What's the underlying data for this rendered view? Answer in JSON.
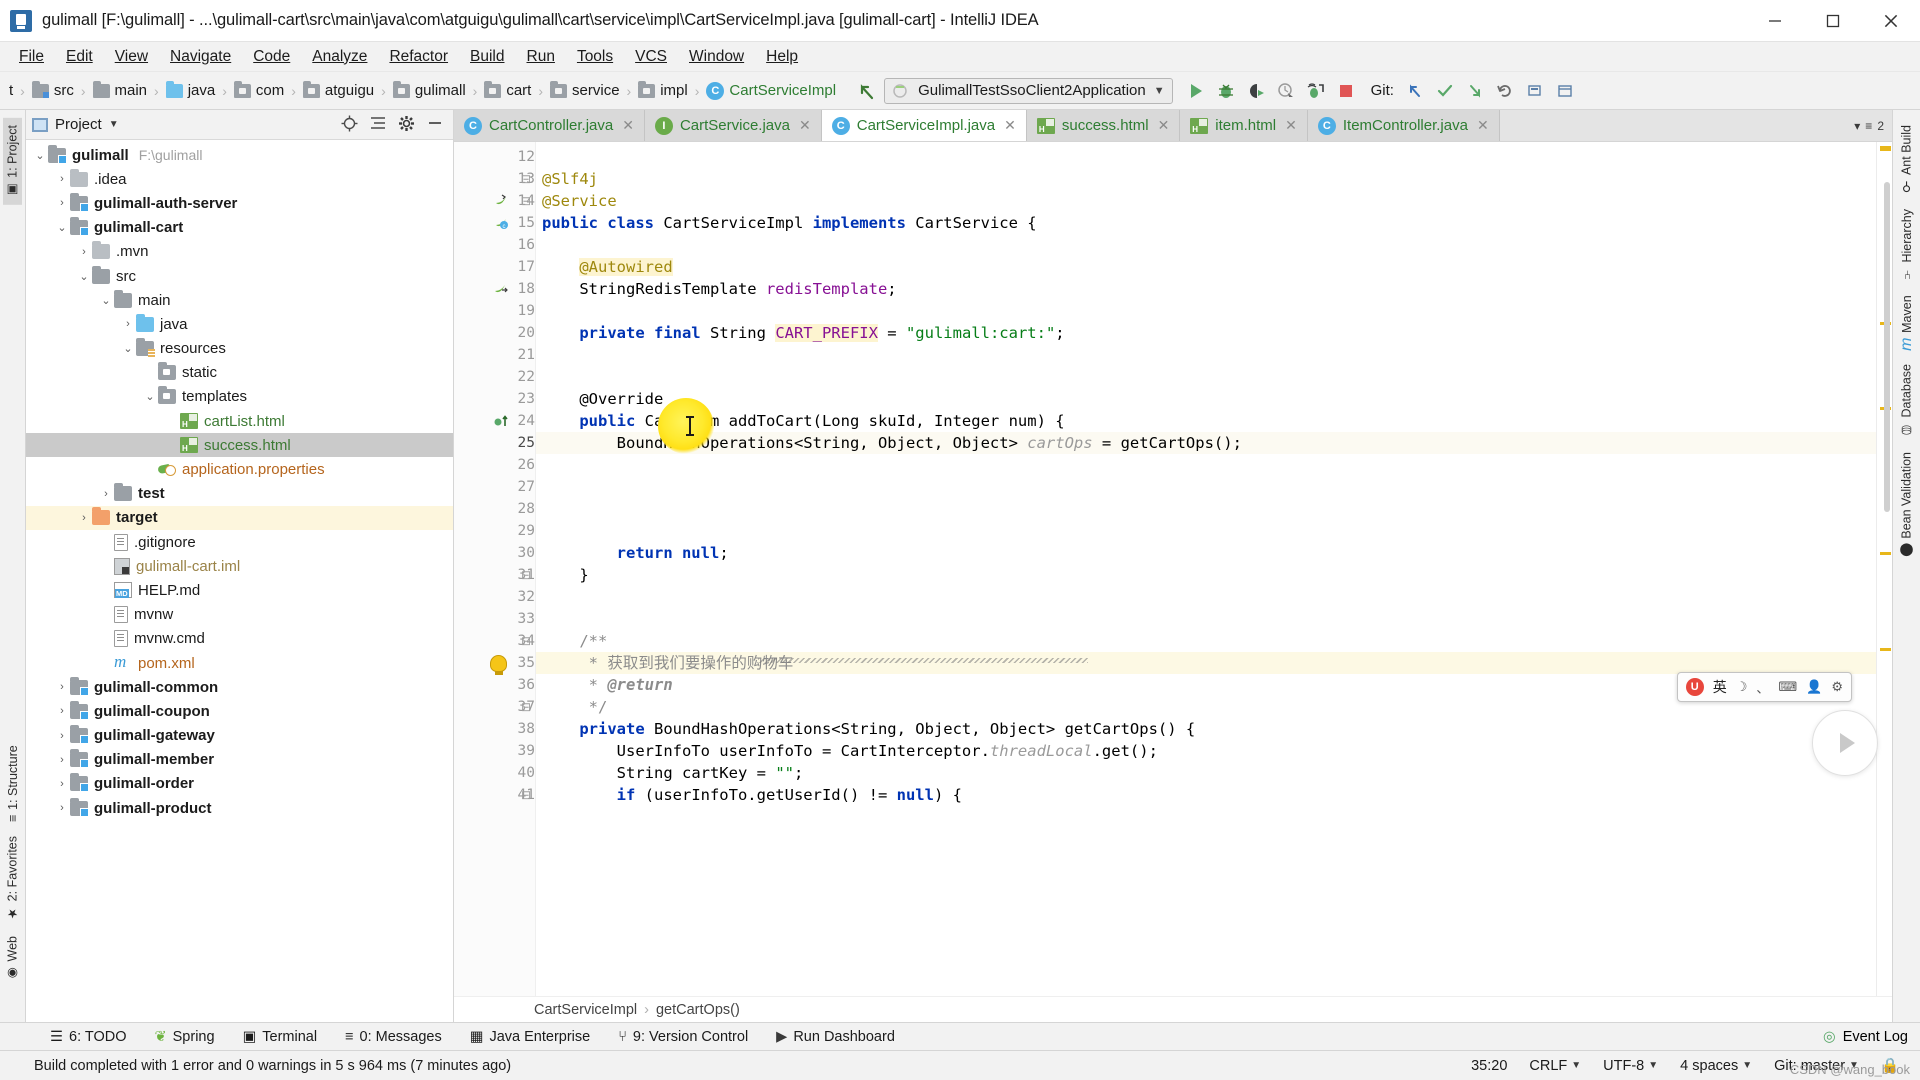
{
  "window": {
    "title": "gulimall [F:\\gulimall] - ...\\gulimall-cart\\src\\main\\java\\com\\atguigu\\gulimall\\cart\\service\\impl\\CartServiceImpl.java [gulimall-cart] - IntelliJ IDEA",
    "app_icon": "intellij-idea-icon",
    "minimize": "minimize-icon",
    "maximize": "maximize-icon",
    "close": "close-icon"
  },
  "menubar": [
    {
      "label": "File"
    },
    {
      "label": "Edit"
    },
    {
      "label": "View"
    },
    {
      "label": "Navigate"
    },
    {
      "label": "Code"
    },
    {
      "label": "Analyze"
    },
    {
      "label": "Refactor"
    },
    {
      "label": "Build"
    },
    {
      "label": "Run"
    },
    {
      "label": "Tools"
    },
    {
      "label": "VCS"
    },
    {
      "label": "Window"
    },
    {
      "label": "Help"
    }
  ],
  "navbar": {
    "crumbs": [
      {
        "label": "t",
        "icon": "partial-crumb"
      },
      {
        "label": "src",
        "icon": "folder-source-icon"
      },
      {
        "label": "main",
        "icon": "folder-icon"
      },
      {
        "label": "java",
        "icon": "folder-java-icon"
      },
      {
        "label": "com",
        "icon": "package-icon"
      },
      {
        "label": "atguigu",
        "icon": "package-icon"
      },
      {
        "label": "gulimall",
        "icon": "package-icon"
      },
      {
        "label": "cart",
        "icon": "package-icon"
      },
      {
        "label": "service",
        "icon": "package-icon"
      },
      {
        "label": "impl",
        "icon": "package-icon"
      },
      {
        "label": "CartServiceImpl",
        "icon": "class-icon"
      }
    ],
    "back_arrow": "back-arrow-icon",
    "run_config": "GulimallTestSsoClient2Application",
    "run_config_dropdown": "chevron-down-icon",
    "buttons": [
      {
        "name": "run-button",
        "icon": "play-icon"
      },
      {
        "name": "debug-button",
        "icon": "bug-icon"
      },
      {
        "name": "run-with-coverage-button",
        "icon": "coverage-icon"
      },
      {
        "name": "profile-button",
        "icon": "profiler-icon"
      },
      {
        "name": "attach-debugger-button",
        "icon": "attach-icon"
      },
      {
        "name": "stop-button",
        "icon": "stop-icon"
      }
    ],
    "git_label": "Git:",
    "git_buttons": [
      {
        "name": "update-project-button",
        "icon": "update-arrow-icon"
      },
      {
        "name": "commit-button",
        "icon": "check-icon"
      },
      {
        "name": "push-button",
        "icon": "push-arrow-icon"
      },
      {
        "name": "rollback-button",
        "icon": "undo-icon"
      },
      {
        "name": "search-everywhere-button",
        "icon": "search-icon"
      },
      {
        "name": "settings-button",
        "icon": "gear-icon"
      }
    ]
  },
  "left_rail": [
    {
      "label": "1: Project",
      "icon": "project-icon",
      "selected": true
    },
    {
      "label": "1: Structure",
      "icon": "structure-icon",
      "selected": false
    },
    {
      "label": "2: Favorites",
      "icon": "star-icon",
      "selected": false
    },
    {
      "label": "Web",
      "icon": "web-icon",
      "selected": false
    }
  ],
  "right_rail": [
    {
      "label": "Ant Build",
      "icon": "ant-icon"
    },
    {
      "label": "Hierarchy",
      "icon": "hierarchy-icon"
    },
    {
      "label": "Maven",
      "icon": "maven-icon"
    },
    {
      "label": "Database",
      "icon": "database-icon"
    },
    {
      "label": "Bean Validation",
      "icon": "bean-icon"
    }
  ],
  "project_panel": {
    "title": "Project",
    "dropdown": "chevron-down-icon",
    "actions": [
      {
        "name": "locate-file-button",
        "icon": "crosshair-icon"
      },
      {
        "name": "collapse-all-button",
        "icon": "collapse-icon"
      },
      {
        "name": "settings-button",
        "icon": "gear-icon"
      },
      {
        "name": "hide-button",
        "icon": "minus-icon"
      }
    ],
    "tree": [
      {
        "label": "gulimall",
        "sub": "F:\\gulimall",
        "indent": 0,
        "arrow": "down",
        "icon": "folder-module",
        "bold": true,
        "color": "default"
      },
      {
        "label": ".idea",
        "indent": 1,
        "arrow": "right",
        "icon": "folder-gray",
        "bold": false,
        "color": "default"
      },
      {
        "label": "gulimall-auth-server",
        "indent": 1,
        "arrow": "right",
        "icon": "folder-module",
        "bold": true,
        "color": "default"
      },
      {
        "label": "gulimall-cart",
        "indent": 1,
        "arrow": "down",
        "icon": "folder-module",
        "bold": true,
        "color": "default"
      },
      {
        "label": ".mvn",
        "indent": 2,
        "arrow": "right",
        "icon": "folder-gray",
        "bold": false,
        "color": "default"
      },
      {
        "label": "src",
        "indent": 2,
        "arrow": "down",
        "icon": "folder",
        "bold": false,
        "color": "default"
      },
      {
        "label": "main",
        "indent": 3,
        "arrow": "down",
        "icon": "folder",
        "bold": false,
        "color": "default"
      },
      {
        "label": "java",
        "indent": 4,
        "arrow": "right",
        "icon": "folder-blue",
        "bold": false,
        "color": "default"
      },
      {
        "label": "resources",
        "indent": 4,
        "arrow": "down",
        "icon": "folder-resources",
        "bold": false,
        "color": "default"
      },
      {
        "label": "static",
        "indent": 5,
        "arrow": "none",
        "icon": "folder-dot",
        "bold": false,
        "color": "default"
      },
      {
        "label": "templates",
        "indent": 5,
        "arrow": "down",
        "icon": "folder-dot",
        "bold": false,
        "color": "default"
      },
      {
        "label": "cartList.html",
        "indent": 6,
        "arrow": "none",
        "icon": "html-file",
        "bold": false,
        "color": "green"
      },
      {
        "label": "success.html",
        "indent": 6,
        "arrow": "none",
        "icon": "html-file",
        "bold": false,
        "color": "green",
        "selected": true
      },
      {
        "label": "application.properties",
        "indent": 5,
        "arrow": "none",
        "icon": "properties-file",
        "bold": false,
        "color": "orange"
      },
      {
        "label": "test",
        "indent": 3,
        "arrow": "right",
        "icon": "folder",
        "bold": true,
        "color": "default"
      },
      {
        "label": "target",
        "indent": 2,
        "arrow": "right",
        "icon": "folder-orange",
        "bold": true,
        "color": "default",
        "highlight": true
      },
      {
        "label": ".gitignore",
        "indent": 3,
        "arrow": "none",
        "icon": "text-file",
        "bold": false,
        "color": "default"
      },
      {
        "label": "gulimall-cart.iml",
        "indent": 3,
        "arrow": "none",
        "icon": "iml-file",
        "bold": false,
        "color": "tan"
      },
      {
        "label": "HELP.md",
        "indent": 3,
        "arrow": "none",
        "icon": "md-file",
        "bold": false,
        "color": "default"
      },
      {
        "label": "mvnw",
        "indent": 3,
        "arrow": "none",
        "icon": "text-file",
        "bold": false,
        "color": "default"
      },
      {
        "label": "mvnw.cmd",
        "indent": 3,
        "arrow": "none",
        "icon": "text-file",
        "bold": false,
        "color": "default"
      },
      {
        "label": "pom.xml",
        "indent": 3,
        "arrow": "none",
        "icon": "maven-file",
        "bold": false,
        "color": "orange"
      },
      {
        "label": "gulimall-common",
        "indent": 1,
        "arrow": "right",
        "icon": "folder-module",
        "bold": true,
        "color": "default"
      },
      {
        "label": "gulimall-coupon",
        "indent": 1,
        "arrow": "right",
        "icon": "folder-module",
        "bold": true,
        "color": "default"
      },
      {
        "label": "gulimall-gateway",
        "indent": 1,
        "arrow": "right",
        "icon": "folder-module",
        "bold": true,
        "color": "default"
      },
      {
        "label": "gulimall-member",
        "indent": 1,
        "arrow": "right",
        "icon": "folder-module",
        "bold": true,
        "color": "default"
      },
      {
        "label": "gulimall-order",
        "indent": 1,
        "arrow": "right",
        "icon": "folder-module",
        "bold": true,
        "color": "default"
      },
      {
        "label": "gulimall-product",
        "indent": 1,
        "arrow": "right",
        "icon": "folder-module",
        "bold": true,
        "color": "default"
      }
    ]
  },
  "editor": {
    "tabs": [
      {
        "label": "CartController.java",
        "icon": "class-icon",
        "active": false
      },
      {
        "label": "CartService.java",
        "icon": "interface-icon",
        "active": false
      },
      {
        "label": "CartServiceImpl.java",
        "icon": "class-icon",
        "active": true
      },
      {
        "label": "success.html",
        "icon": "html-icon",
        "active": false
      },
      {
        "label": "item.html",
        "icon": "html-icon",
        "active": false
      },
      {
        "label": "ItemController.java",
        "icon": "class-icon",
        "active": false
      }
    ],
    "tabs_overflow": "2",
    "first_line": 12,
    "lines": [
      {
        "n": 12,
        "tokens": [],
        "gutter": null,
        "fold": null
      },
      {
        "n": 13,
        "tokens": [
          {
            "t": "@Slf4j",
            "c": "an"
          }
        ],
        "gutter": null,
        "fold": "collapse"
      },
      {
        "n": 14,
        "tokens": [
          {
            "t": "@Service",
            "c": "an"
          }
        ],
        "gutter": "spring-bean-icon",
        "fold": "collapse"
      },
      {
        "n": 15,
        "tokens": [
          {
            "t": "public class ",
            "c": "kw"
          },
          {
            "t": "CartServiceImpl ",
            "c": "cn"
          },
          {
            "t": "implements ",
            "c": "kw"
          },
          {
            "t": "CartService {",
            "c": "cn"
          }
        ],
        "gutter": "implements-icon",
        "fold": null
      },
      {
        "n": 16,
        "tokens": [],
        "gutter": null,
        "fold": null
      },
      {
        "n": 17,
        "tokens": [
          {
            "t": "    ",
            "c": "plain"
          },
          {
            "t": "@Autowired",
            "c": "anh"
          }
        ],
        "gutter": null,
        "fold": null
      },
      {
        "n": 18,
        "tokens": [
          {
            "t": "    StringRedisTemplate ",
            "c": "cn"
          },
          {
            "t": "redisTemplate",
            "c": "fld"
          },
          {
            "t": ";",
            "c": "cn"
          }
        ],
        "gutter": "bean-autowired-icon",
        "fold": null
      },
      {
        "n": 19,
        "tokens": [],
        "gutter": null,
        "fold": null
      },
      {
        "n": 20,
        "tokens": [
          {
            "t": "    ",
            "c": "plain"
          },
          {
            "t": "private final ",
            "c": "kw"
          },
          {
            "t": "String ",
            "c": "cn"
          },
          {
            "t": "CART_PREFIX",
            "c": "cfld"
          },
          {
            "t": " = ",
            "c": "cn"
          },
          {
            "t": "\"gulimall:cart:\"",
            "c": "str"
          },
          {
            "t": ";",
            "c": "cn"
          }
        ],
        "gutter": null,
        "fold": null
      },
      {
        "n": 21,
        "tokens": [],
        "gutter": null,
        "fold": null
      },
      {
        "n": 22,
        "tokens": [],
        "gutter": null,
        "fold": null
      },
      {
        "n": 23,
        "tokens": [
          {
            "t": "    ",
            "c": "plain"
          },
          {
            "t": "@Override",
            "c": "cn"
          }
        ],
        "gutter": null,
        "fold": null
      },
      {
        "n": 24,
        "tokens": [
          {
            "t": "    ",
            "c": "plain"
          },
          {
            "t": "public ",
            "c": "kw"
          },
          {
            "t": "CartItem addToCart(Long skuId, Integer num) {",
            "c": "cn"
          }
        ],
        "gutter": "override-icon",
        "fold": null
      },
      {
        "n": 25,
        "tokens": [
          {
            "t": "        BoundHashOperations<String, Object, Object> ",
            "c": "cn"
          },
          {
            "t": "cartOps",
            "c": "gray"
          },
          {
            "t": " = getCartOps();",
            "c": "cn"
          }
        ],
        "gutter": null,
        "fold": null,
        "current": true
      },
      {
        "n": 26,
        "tokens": [],
        "gutter": null,
        "fold": null
      },
      {
        "n": 27,
        "tokens": [],
        "gutter": null,
        "fold": null
      },
      {
        "n": 28,
        "tokens": [],
        "gutter": null,
        "fold": null
      },
      {
        "n": 29,
        "tokens": [],
        "gutter": null,
        "fold": null
      },
      {
        "n": 30,
        "tokens": [
          {
            "t": "        ",
            "c": "plain"
          },
          {
            "t": "return null",
            "c": "kw"
          },
          {
            "t": ";",
            "c": "cn"
          }
        ],
        "gutter": null,
        "fold": null
      },
      {
        "n": 31,
        "tokens": [
          {
            "t": "    }",
            "c": "cn"
          }
        ],
        "gutter": null,
        "fold": "collapse"
      },
      {
        "n": 32,
        "tokens": [],
        "gutter": null,
        "fold": null
      },
      {
        "n": 33,
        "tokens": [],
        "gutter": null,
        "fold": null
      },
      {
        "n": 34,
        "tokens": [
          {
            "t": "    ",
            "c": "plain"
          },
          {
            "t": "/**",
            "c": "cmt"
          }
        ],
        "gutter": null,
        "fold": "collapse"
      },
      {
        "n": 35,
        "tokens": [
          {
            "t": "     ",
            "c": "plain"
          },
          {
            "t": "* 获取到我们要操作的购物车",
            "c": "cmt"
          }
        ],
        "gutter": "intention-bulb-icon",
        "fold": null,
        "highlight": true
      },
      {
        "n": 36,
        "tokens": [
          {
            "t": "     ",
            "c": "plain"
          },
          {
            "t": "* ",
            "c": "cmt"
          },
          {
            "t": "@return",
            "c": "cmtb"
          }
        ],
        "gutter": null,
        "fold": null
      },
      {
        "n": 37,
        "tokens": [
          {
            "t": "     ",
            "c": "plain"
          },
          {
            "t": "*/",
            "c": "cmt"
          }
        ],
        "gutter": null,
        "fold": "collapse"
      },
      {
        "n": 38,
        "tokens": [
          {
            "t": "    ",
            "c": "plain"
          },
          {
            "t": "private ",
            "c": "kw"
          },
          {
            "t": "BoundHashOperations<String, Object, Object> getCartOps() {",
            "c": "cn"
          }
        ],
        "gutter": null,
        "fold": null
      },
      {
        "n": 39,
        "tokens": [
          {
            "t": "        UserInfoTo userInfoTo = CartInterceptor.",
            "c": "cn"
          },
          {
            "t": "threadLocal",
            "c": "gray"
          },
          {
            "t": ".get();",
            "c": "cn"
          }
        ],
        "gutter": null,
        "fold": null
      },
      {
        "n": 40,
        "tokens": [
          {
            "t": "        String ",
            "c": "cn"
          },
          {
            "t": "cartKey",
            "c": "cn"
          },
          {
            "t": " = ",
            "c": "cn"
          },
          {
            "t": "\"\"",
            "c": "str"
          },
          {
            "t": ";",
            "c": "cn"
          }
        ],
        "gutter": null,
        "fold": null
      },
      {
        "n": 41,
        "tokens": [
          {
            "t": "        ",
            "c": "plain"
          },
          {
            "t": "if ",
            "c": "kw"
          },
          {
            "t": "(userInfoTo.getUserId() != ",
            "c": "cn"
          },
          {
            "t": "null",
            "c": "kw"
          },
          {
            "t": ") {",
            "c": "cn"
          }
        ],
        "gutter": null,
        "fold": "collapse"
      }
    ],
    "breadcrumb": [
      "CartServiceImpl",
      "getCartOps()"
    ]
  },
  "toolwindow_bar": {
    "items": [
      {
        "label": "6: TODO",
        "icon": "todo-icon",
        "accel": "6"
      },
      {
        "label": "Spring",
        "icon": "spring-icon"
      },
      {
        "label": "Terminal",
        "icon": "terminal-icon"
      },
      {
        "label": "0: Messages",
        "icon": "messages-icon",
        "accel": "0"
      },
      {
        "label": "Java Enterprise",
        "icon": "java-ee-icon"
      },
      {
        "label": "9: Version Control",
        "icon": "version-control-icon",
        "accel": "9"
      },
      {
        "label": "Run Dashboard",
        "icon": "run-dashboard-icon"
      }
    ],
    "event_log": "Event Log",
    "event_log_icon": "event-log-icon"
  },
  "statusbar": {
    "message": "Build completed with 1 error and 0 warnings in 5 s 964 ms (7 minutes ago)",
    "position": "35:20",
    "line_sep": "CRLF",
    "encoding": "UTF-8",
    "indent": "4 spaces",
    "branch": "Git: master",
    "lock_icon": "lock-icon"
  },
  "ime_widget": {
    "logo": "U",
    "mode": "英",
    "glyphs": [
      "☽",
      "、",
      "⌨",
      "👤",
      "⚙"
    ]
  },
  "watermark": "CSDN @wang_book"
}
